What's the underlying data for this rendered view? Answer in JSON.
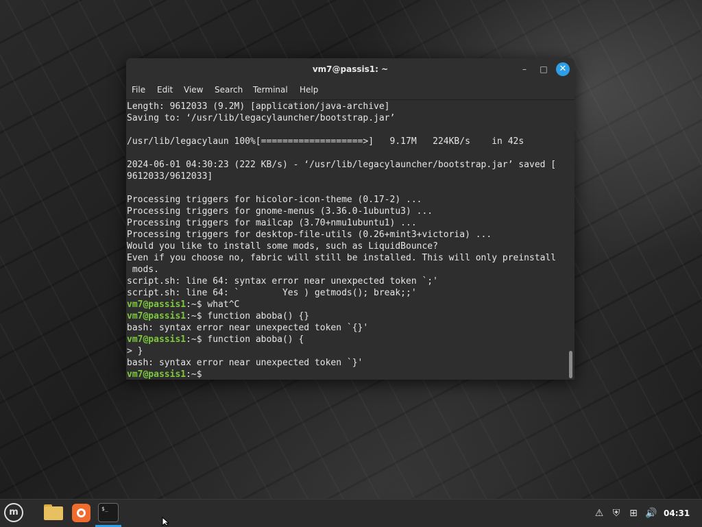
{
  "window": {
    "title": "vm7@passis1: ~",
    "controls": {
      "minimize": "–",
      "maximize": "□",
      "close": "✕"
    }
  },
  "menubar": {
    "items": [
      "File",
      "Edit",
      "View",
      "Search",
      "Terminal",
      "Help"
    ]
  },
  "terminal": {
    "prompt_user": "vm7@passis1",
    "prompt_sep": ":~$ ",
    "lines": [
      {
        "type": "out",
        "text": "Length: 9612033 (9.2M) [application/java-archive]"
      },
      {
        "type": "out",
        "text": "Saving to: ‘/usr/lib/legacylauncher/bootstrap.jar’"
      },
      {
        "type": "out",
        "text": ""
      },
      {
        "type": "out",
        "text": "/usr/lib/legacylaun 100%[===================>]   9.17M   224KB/s    in 42s"
      },
      {
        "type": "out",
        "text": ""
      },
      {
        "type": "out",
        "text": "2024-06-01 04:30:23 (222 KB/s) - ‘/usr/lib/legacylauncher/bootstrap.jar’ saved ["
      },
      {
        "type": "out",
        "text": "9612033/9612033]"
      },
      {
        "type": "out",
        "text": ""
      },
      {
        "type": "out",
        "text": "Processing triggers for hicolor-icon-theme (0.17-2) ..."
      },
      {
        "type": "out",
        "text": "Processing triggers for gnome-menus (3.36.0-1ubuntu3) ..."
      },
      {
        "type": "out",
        "text": "Processing triggers for mailcap (3.70+nmu1ubuntu1) ..."
      },
      {
        "type": "out",
        "text": "Processing triggers for desktop-file-utils (0.26+mint3+victoria) ..."
      },
      {
        "type": "out",
        "text": "Would you like to install some mods, such as LiquidBounce?"
      },
      {
        "type": "out",
        "text": "Even if you choose no, fabric will still be installed. This will only preinstall"
      },
      {
        "type": "out",
        "text": " mods."
      },
      {
        "type": "out",
        "text": "script.sh: line 64: syntax error near unexpected token `;'"
      },
      {
        "type": "out",
        "text": "script.sh: line 64: `        Yes ) getmods(); break;;'"
      },
      {
        "type": "cmd",
        "text": "what^C"
      },
      {
        "type": "cmd",
        "text": "function aboba() {}"
      },
      {
        "type": "out",
        "text": "bash: syntax error near unexpected token `{}'"
      },
      {
        "type": "cmd",
        "text": "function aboba() {"
      },
      {
        "type": "out",
        "text": "> }"
      },
      {
        "type": "out",
        "text": "bash: syntax error near unexpected token `}'"
      },
      {
        "type": "cmd",
        "text": ""
      }
    ]
  },
  "taskbar": {
    "menu_icon": "mint-logo-icon",
    "menu_glyph": "m",
    "apps": [
      {
        "name": "files",
        "icon": "folder-icon"
      },
      {
        "name": "firefox",
        "icon": "firefox-icon"
      },
      {
        "name": "terminal",
        "icon": "terminal-icon",
        "label": "$_",
        "active": true
      }
    ],
    "tray": [
      {
        "name": "update-manager-icon",
        "glyph": "⚠"
      },
      {
        "name": "shield-icon",
        "glyph": "⛨"
      },
      {
        "name": "network-icon",
        "glyph": "⊞"
      },
      {
        "name": "volume-icon",
        "glyph": "🔊"
      }
    ],
    "clock": "04:31"
  },
  "colors": {
    "accent": "#2f9ee8",
    "prompt": "#7ec93e",
    "terminal_bg": "#2e2e2e",
    "terminal_fg": "#e5e5e5"
  }
}
